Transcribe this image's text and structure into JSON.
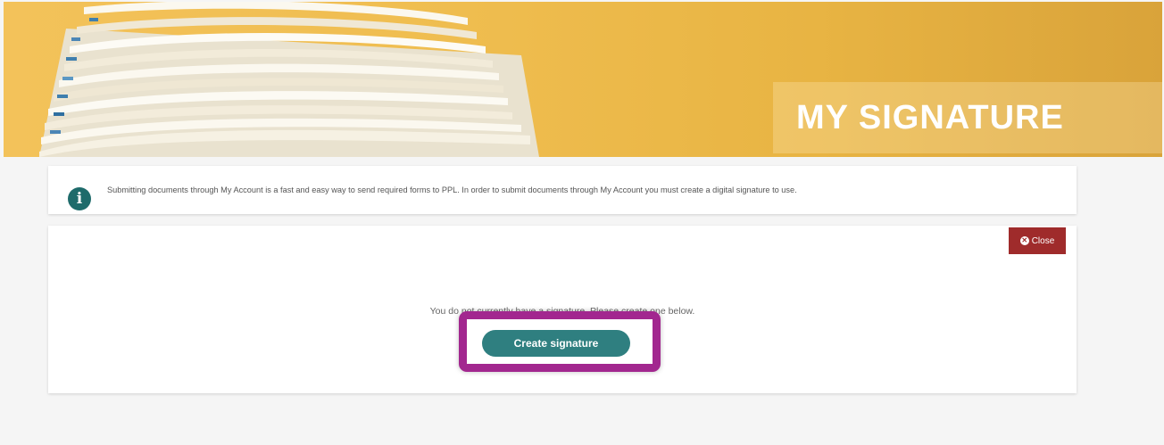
{
  "banner": {
    "title": "MY SIGNATURE"
  },
  "info": {
    "icon": "info-icon",
    "icon_glyph": "i",
    "text": "Submitting documents through My Account is a fast and easy way to send required forms to PPL. In order to submit documents through My Account you must create a digital signature to use."
  },
  "main": {
    "close_label": "Close",
    "close_icon": "close-icon",
    "message": "You do not currently have a signature. Please create one below.",
    "create_button_label": "Create signature"
  },
  "colors": {
    "banner_gold": "#efbd4f",
    "info_icon_teal": "#1e6b6b",
    "close_red": "#9f2b2b",
    "button_teal": "#2f7f80",
    "highlight_purple": "#a2278f"
  }
}
